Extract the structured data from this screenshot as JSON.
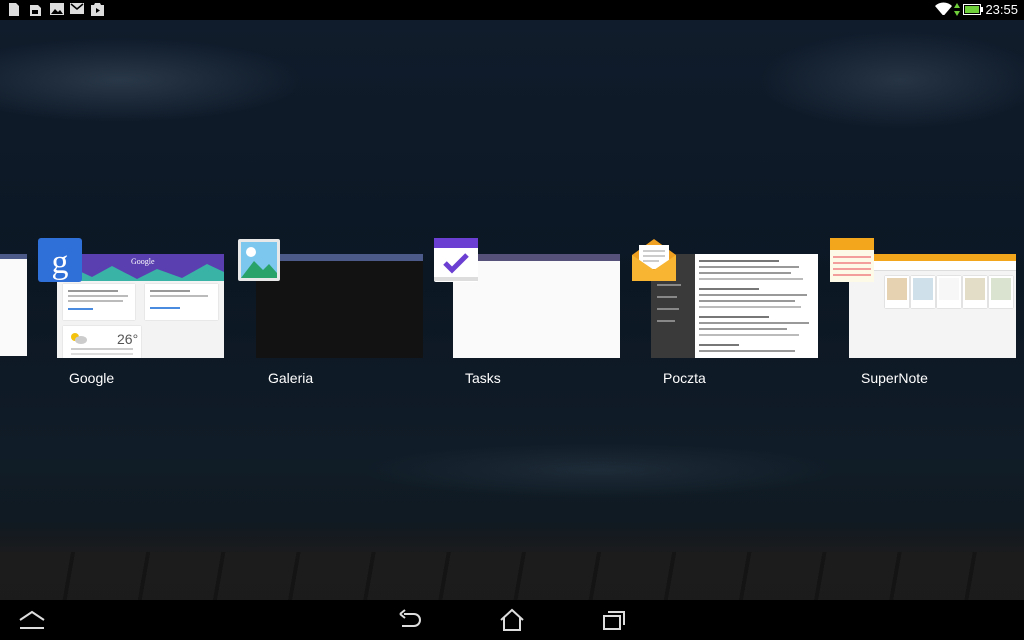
{
  "status_bar": {
    "time": "23:55",
    "left_icons": [
      "file-icon",
      "sim-card-icon",
      "image-icon",
      "gmail-icon",
      "play-store-icon"
    ],
    "right_icons": [
      "wifi-icon",
      "battery-icon"
    ]
  },
  "recent_apps": [
    {
      "label": "Google"
    },
    {
      "label": "Galeria"
    },
    {
      "label": "Tasks"
    },
    {
      "label": "Poczta"
    },
    {
      "label": "SuperNote"
    }
  ],
  "google_thumb": {
    "header_text": "Google",
    "weather_temp": "26°"
  },
  "nav_bar": {
    "buttons": [
      "recent-apps-toggle",
      "back",
      "home",
      "recent-apps"
    ]
  },
  "colors": {
    "google_header": "#5a3fb0",
    "tasks_accent": "#6a3fd1",
    "supernote_accent": "#f3a51c",
    "galeria_accent": "#4aa3df"
  }
}
